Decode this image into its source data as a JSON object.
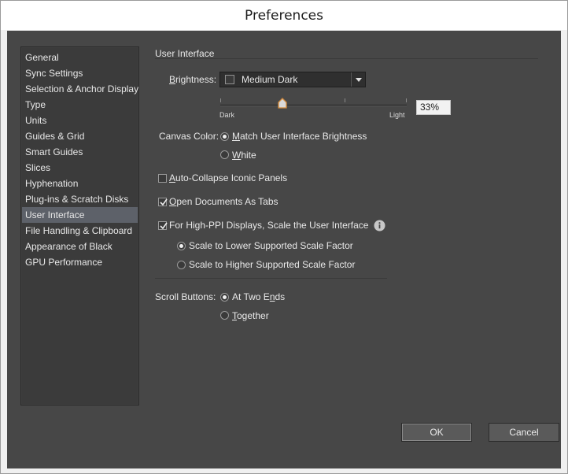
{
  "window": {
    "title": "Preferences"
  },
  "sidebar": {
    "items": [
      {
        "label": "General"
      },
      {
        "label": "Sync Settings"
      },
      {
        "label": "Selection & Anchor Display"
      },
      {
        "label": "Type"
      },
      {
        "label": "Units"
      },
      {
        "label": "Guides & Grid"
      },
      {
        "label": "Smart Guides"
      },
      {
        "label": "Slices"
      },
      {
        "label": "Hyphenation"
      },
      {
        "label": "Plug-ins & Scratch Disks"
      },
      {
        "label": "User Interface"
      },
      {
        "label": "File Handling & Clipboard"
      },
      {
        "label": "Appearance of Black"
      },
      {
        "label": "GPU Performance"
      }
    ],
    "selected": "User Interface"
  },
  "content": {
    "section_title": "User Interface",
    "brightness": {
      "label_underlined": "B",
      "label_rest": "rightness:",
      "value": "Medium Dark",
      "slider_min": "Dark",
      "slider_max": "Light",
      "percent": "33%",
      "level": 0.33
    },
    "canvas_color": {
      "label": "Canvas Color:",
      "option1_underlined": "M",
      "option1_rest": "atch User Interface Brightness",
      "option2_underlined": "W",
      "option2_rest": "hite",
      "selected": "Match User Interface Brightness"
    },
    "auto_collapse": {
      "underlined": "A",
      "rest": "uto-Collapse Iconic Panels",
      "checked": false
    },
    "open_docs_tabs": {
      "underlined": "O",
      "rest": "pen Documents As Tabs",
      "checked": true
    },
    "high_ppi": {
      "label": "For High-PPI Displays, Scale the User Interface",
      "checked": true,
      "option1": "Scale to Lower Supported Scale Factor",
      "option2": "Scale to Higher Supported Scale Factor",
      "selected": "Scale to Lower Supported Scale Factor"
    },
    "scroll_buttons": {
      "label": "Scroll Buttons:",
      "option1_pre": "At Two E",
      "option1_underlined": "n",
      "option1_post": "ds",
      "option2_underlined": "T",
      "option2_rest": "ogether",
      "selected": "At Two Ends"
    }
  },
  "buttons": {
    "ok": "OK",
    "cancel": "Cancel"
  },
  "colors": {
    "panel_bg": "#474747",
    "sidebar_bg": "#3b3b3b",
    "selection": "#5d6169",
    "accent_thumb": "#d58a3a"
  }
}
